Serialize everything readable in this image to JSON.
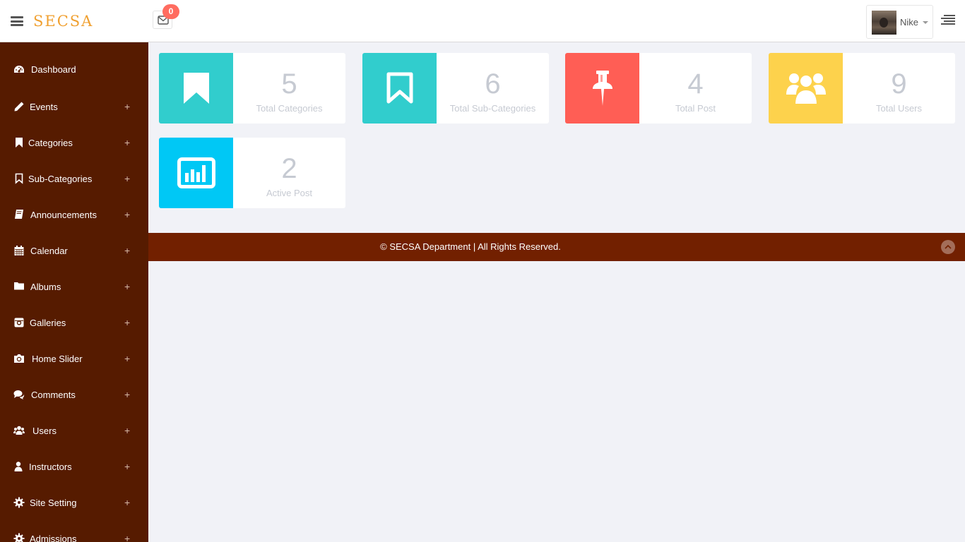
{
  "header": {
    "brand": "SECSA",
    "messages_count": "0",
    "user_name": "Nike",
    "icons": {
      "menu": "hamburger-icon",
      "mail": "envelope-icon",
      "right_menu": "align-right-icon"
    }
  },
  "sidebar": {
    "items": [
      {
        "label": "Dashboard",
        "icon": "dashboard-icon"
      },
      {
        "label": "Events",
        "icon": "pencil-icon",
        "expand": "+"
      },
      {
        "label": "Categories",
        "icon": "bookmark-icon",
        "expand": "+"
      },
      {
        "label": "Sub-Categories",
        "icon": "bookmark-outline-icon",
        "expand": "+"
      },
      {
        "label": "Announcements",
        "icon": "book-icon",
        "expand": "+"
      },
      {
        "label": "Calendar",
        "icon": "calendar-icon",
        "expand": "+"
      },
      {
        "label": "Albums",
        "icon": "folder-icon",
        "expand": "+"
      },
      {
        "label": "Galleries",
        "icon": "instagram-icon",
        "expand": "+"
      },
      {
        "label": "Home Slider",
        "icon": "camera-icon",
        "expand": "+"
      },
      {
        "label": "Comments",
        "icon": "comments-icon",
        "expand": "+"
      },
      {
        "label": "Users",
        "icon": "users-icon",
        "expand": "+"
      },
      {
        "label": "Instructors",
        "icon": "user-icon",
        "expand": "+"
      },
      {
        "label": "Site Setting",
        "icon": "gear-icon",
        "expand": "+"
      },
      {
        "label": "Admissions",
        "icon": "gear-icon",
        "expand": "+"
      }
    ]
  },
  "cards": [
    {
      "value": "5",
      "label": "Total Categories",
      "color": "#31cdcd",
      "icon": "bookmark-icon"
    },
    {
      "value": "6",
      "label": "Total Sub-Categories",
      "color": "#31cdcd",
      "icon": "bookmark-outline-icon"
    },
    {
      "value": "4",
      "label": "Total Post",
      "color": "#ff5e55",
      "icon": "thumbtack-icon"
    },
    {
      "value": "9",
      "label": "Total Users",
      "color": "#fdd24c",
      "icon": "users-icon"
    },
    {
      "value": "2",
      "label": "Active Post",
      "color": "#00c8f5",
      "icon": "bar-chart-icon"
    }
  ],
  "footer": {
    "text": "© SECSA Department | All Rights Reserved.",
    "scroll_icon": "chevron-up-icon"
  },
  "colors": {
    "sidebar": "#561b00",
    "footer": "#722000",
    "brand": "#f0a030",
    "badge": "#ff6c60"
  }
}
